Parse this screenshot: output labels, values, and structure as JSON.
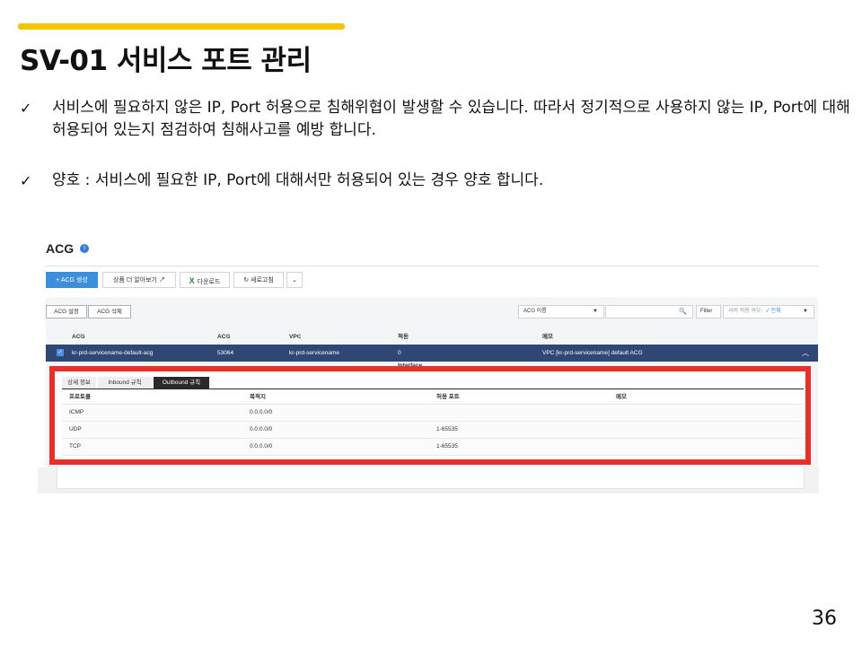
{
  "slide": {
    "title": "SV-01 서비스 포트 관리",
    "bullets": [
      {
        "check": "✓",
        "text": "서비스에 필요하지 않은 IP, Port 허용으로 침해위협이 발생할 수 있습니다. 따라서 정기적으로 사용하지 않는 IP, Port에 대해 허용되어 있는지 점검하여 침해사고를 예방 합니다."
      },
      {
        "check": "✓",
        "text": "양호 : 서비스에 필요한 IP, Port에 대해서만 허용되어 있는 경우 양호 합니다."
      }
    ],
    "page_number": "36"
  },
  "console": {
    "title": "ACG",
    "info_icon": "i",
    "toolbar": {
      "create": "+ ACG 생성",
      "learn_more": "상품 더 알아보기 ↗",
      "download_icon": "X",
      "download": "다운로드",
      "refresh": "↻ 새로고침",
      "more": "⌄"
    },
    "actions": {
      "settings": "ACG 설정",
      "delete": "ACG 삭제"
    },
    "search": {
      "select_value": "ACG 이름",
      "select_arrow": "▼",
      "search_icon": "🔍",
      "filter": "Filter",
      "server_filter_label": "서버 적용 여부:",
      "server_filter_value": "✓ 전체",
      "server_filter_arrow": "▼"
    },
    "table": {
      "headers": [
        "ACG 이름",
        "ACG ID",
        "VPC 이름",
        "적용 Network Interface 수",
        "메모"
      ],
      "sort_glyph": "⇕",
      "row": {
        "checkbox": "✓",
        "name": "kr-prd-servicename-default-acg",
        "id": "53064",
        "vpc": "kr-prd-servicename",
        "ni_count": "0",
        "memo": "VPC [kr-prd-servicename] default ACG",
        "collapse": "︿"
      }
    },
    "detail": {
      "tabs": [
        "상세 정보",
        "Inbound 규칙",
        "Outbound 규칙"
      ],
      "active_tab": 2,
      "headers": [
        "프로토콜",
        "목적지",
        "허용 포트",
        "메모"
      ],
      "rules": [
        {
          "protocol": "ICMP",
          "destination": "0.0.0.0/0",
          "port": "",
          "memo": ""
        },
        {
          "protocol": "UDP",
          "destination": "0.0.0.0/0",
          "port": "1-65535",
          "memo": ""
        },
        {
          "protocol": "TCP",
          "destination": "0.0.0.0/0",
          "port": "1-65535",
          "memo": ""
        }
      ]
    }
  },
  "colors": {
    "accent_bar": "#f5c400",
    "highlight_border": "#e8302a",
    "selected_row": "#2f4775",
    "primary_button": "#3d8fdb"
  }
}
